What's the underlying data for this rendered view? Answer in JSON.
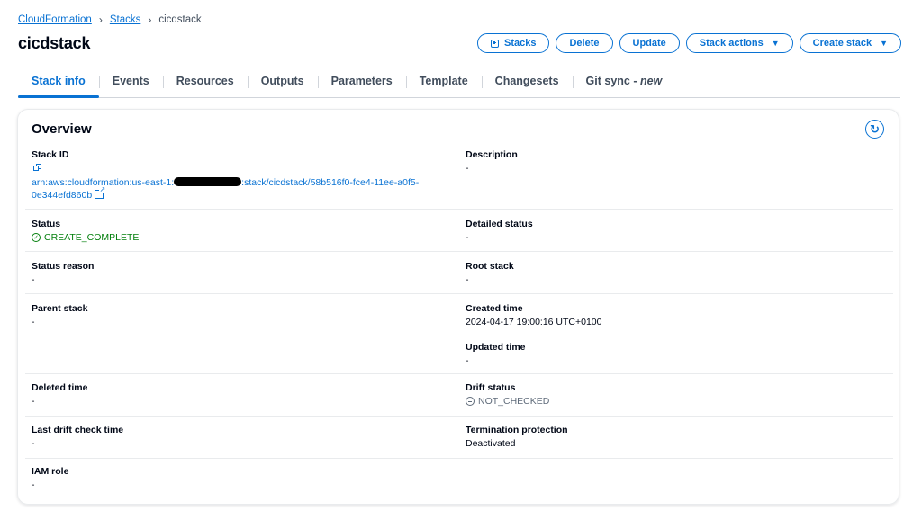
{
  "breadcrumb": {
    "root": "CloudFormation",
    "parent": "Stacks",
    "current": "cicdstack"
  },
  "page": {
    "title": "cicdstack"
  },
  "actions": {
    "stacks": "Stacks",
    "delete": "Delete",
    "update": "Update",
    "stack_actions": "Stack actions",
    "create_stack": "Create stack"
  },
  "tabs": [
    {
      "label": "Stack info",
      "active": true
    },
    {
      "label": "Events"
    },
    {
      "label": "Resources"
    },
    {
      "label": "Outputs"
    },
    {
      "label": "Parameters"
    },
    {
      "label": "Template"
    },
    {
      "label": "Changesets"
    },
    {
      "label": "Git sync - ",
      "suffix": "new"
    }
  ],
  "overview": {
    "title": "Overview",
    "stack_id": {
      "label": "Stack ID",
      "arn_prefix": "arn:aws:cloudformation:us-east-1:",
      "arn_suffix": ":stack/cicdstack/58b516f0-fce4-11ee-a0f5-",
      "arn_tail": "0e344efd860b"
    },
    "description": {
      "label": "Description",
      "value": "-"
    },
    "status": {
      "label": "Status",
      "value": "CREATE_COMPLETE",
      "color": "#037f0c"
    },
    "detailed_status": {
      "label": "Detailed status",
      "value": "-"
    },
    "status_reason": {
      "label": "Status reason",
      "value": "-"
    },
    "root_stack": {
      "label": "Root stack",
      "value": "-"
    },
    "parent_stack": {
      "label": "Parent stack",
      "value": "-"
    },
    "created_time": {
      "label": "Created time",
      "value": "2024-04-17 19:00:16 UTC+0100"
    },
    "updated_time": {
      "label": "Updated time",
      "value": "-"
    },
    "deleted_time": {
      "label": "Deleted time",
      "value": "-"
    },
    "drift_status": {
      "label": "Drift status",
      "value": "NOT_CHECKED"
    },
    "last_drift_check": {
      "label": "Last drift check time",
      "value": "-"
    },
    "termination_protection": {
      "label": "Termination protection",
      "value": "Deactivated"
    },
    "iam_role": {
      "label": "IAM role",
      "value": "-"
    }
  },
  "colors": {
    "accent": "#0972d3",
    "success": "#037f0c",
    "text": "#000716",
    "muted": "#5f6b7a"
  }
}
